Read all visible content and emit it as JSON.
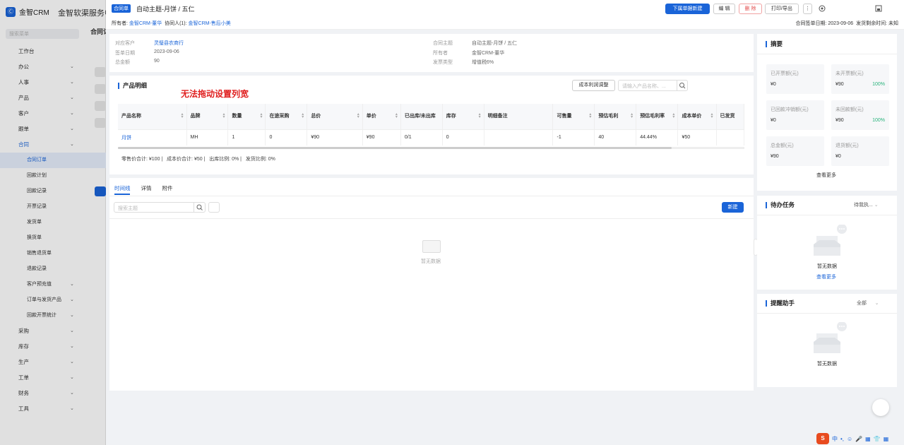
{
  "sidebar": {
    "brand": "金智CRM",
    "app_title": "金智软渠服务中心",
    "search_placeholder": "搜索菜单",
    "menu": [
      {
        "label": "工作台",
        "chev": false,
        "type": "top"
      },
      {
        "label": "办公",
        "chev": true,
        "type": "top"
      },
      {
        "label": "人事",
        "chev": true,
        "type": "top"
      },
      {
        "label": "产品",
        "chev": true,
        "type": "top"
      },
      {
        "label": "客户",
        "chev": true,
        "type": "top"
      },
      {
        "label": "跟单",
        "chev": true,
        "type": "top"
      },
      {
        "label": "合同",
        "chev": true,
        "type": "open"
      },
      {
        "label": "合同订单",
        "chev": false,
        "type": "active"
      },
      {
        "label": "回款计划",
        "chev": false,
        "type": "sub"
      },
      {
        "label": "回款记录",
        "chev": false,
        "type": "sub"
      },
      {
        "label": "开票记录",
        "chev": false,
        "type": "sub"
      },
      {
        "label": "发货单",
        "chev": false,
        "type": "sub"
      },
      {
        "label": "换货单",
        "chev": false,
        "type": "sub"
      },
      {
        "label": "销售退货单",
        "chev": false,
        "type": "sub"
      },
      {
        "label": "退款记录",
        "chev": false,
        "type": "sub"
      },
      {
        "label": "客户预充值",
        "chev": true,
        "type": "sub"
      },
      {
        "label": "订单与发货产品",
        "chev": true,
        "type": "sub"
      },
      {
        "label": "回款开票统计",
        "chev": true,
        "type": "sub"
      },
      {
        "label": "采购",
        "chev": true,
        "type": "top"
      },
      {
        "label": "库存",
        "chev": true,
        "type": "top"
      },
      {
        "label": "生产",
        "chev": true,
        "type": "top"
      },
      {
        "label": "工单",
        "chev": true,
        "type": "top"
      },
      {
        "label": "财务",
        "chev": true,
        "type": "top"
      },
      {
        "label": "工具",
        "chev": true,
        "type": "top"
      }
    ],
    "behind_header": "合同订"
  },
  "header": {
    "tag": "合同单",
    "title": "自动主题-月饼 / 五仁",
    "owner_label": "所有者:",
    "owner": "金智CRM-董华",
    "collab_label": "协同人(1):",
    "collab": "金智CRM-售后小美",
    "sign_date_label": "合同签单日期:",
    "sign_date": "2023-09-06",
    "remaining_label": "发货剩余时间:",
    "remaining": "未知",
    "btn_next": "下属单据新建",
    "btn_edit": "编 辑",
    "btn_delete": "删 除",
    "btn_print": "打印/导出",
    "more_glyph": "⋮"
  },
  "info": {
    "left": [
      {
        "label": "对应客户",
        "value": "灵璧县农商行",
        "link": true
      },
      {
        "label": "签单日期",
        "value": "2023-09-06",
        "link": false
      },
      {
        "label": "总金额",
        "value": "90",
        "link": false
      }
    ],
    "right": [
      {
        "label": "合同主题",
        "value": "自动主题-月饼 / 五仁"
      },
      {
        "label": "所有者",
        "value": "金智CRM-董华"
      },
      {
        "label": "发票类型",
        "value": "增值税6%"
      }
    ]
  },
  "products": {
    "title": "产品明细",
    "cost_btn": "成本利润调整",
    "search_placeholder": "请输入产品名称、...",
    "annotation": "无法拖动设置列宽",
    "columns": [
      "产品名称",
      "品牌",
      "数量",
      "在途采购",
      "总价",
      "单价",
      "已出库/未出库",
      "库存",
      "明细备注",
      "可售量",
      "预估毛利",
      "预估毛利率",
      "成本单价",
      "已发货"
    ],
    "rows": [
      [
        "月饼",
        "MH",
        "1",
        "0",
        "¥90",
        "¥90",
        "0/1",
        "0",
        "",
        "-1",
        "40",
        "44.44%",
        "¥50",
        ""
      ]
    ],
    "summary": "零售价合计: ¥100 |   成本价合计: ¥50 |   出库比例: 0% |   发货比例: 0%"
  },
  "timeline": {
    "tabs": [
      "时间线",
      "详情",
      "附件"
    ],
    "search_placeholder": "搜索主题",
    "new_btn": "新建",
    "empty": "暂无数据"
  },
  "summary_panel": {
    "title": "摘要",
    "boxes": [
      {
        "label": "已开票额(元)",
        "value": "¥0",
        "pct": ""
      },
      {
        "label": "未开票额(元)",
        "value": "¥90",
        "pct": "100%"
      },
      {
        "label": "已回款冲销额(元)",
        "value": "¥0",
        "pct": ""
      },
      {
        "label": "未回款额(元)",
        "value": "¥90",
        "pct": "100%"
      },
      {
        "label": "总金额(元)",
        "value": "¥90",
        "pct": ""
      },
      {
        "label": "退货额(元)",
        "value": "¥0",
        "pct": ""
      }
    ],
    "more": "查看更多"
  },
  "todo": {
    "title": "待办任务",
    "filter": "待我执...",
    "empty": "暂无数据",
    "more": "查看更多"
  },
  "reminder": {
    "title": "提醒助手",
    "filter": "全部",
    "empty": "暂无数据"
  },
  "ime": {
    "logo": "S",
    "lang": "中",
    "items": [
      "•,",
      "☺",
      "🎤",
      "▦",
      "👕",
      "▦"
    ]
  },
  "colors": {
    "primary": "#1a64d8",
    "danger": "#e34d4d",
    "success": "#27b27b",
    "annotation": "#e02020"
  }
}
